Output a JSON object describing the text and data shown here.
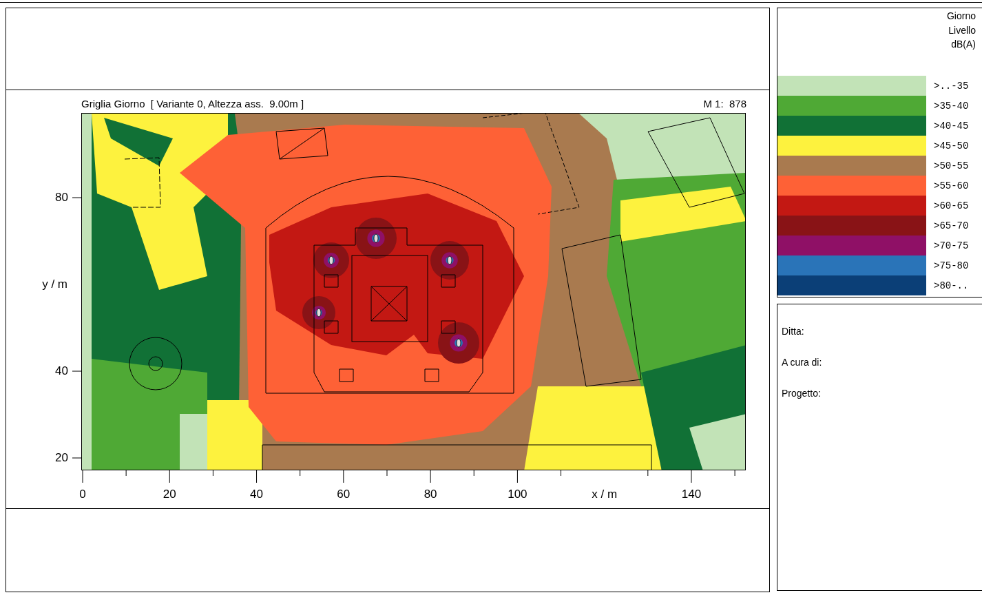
{
  "map_header": {
    "title": "Griglia Giorno  [ Variante 0, Altezza ass.  9.00m ]",
    "scale": "M 1:  878"
  },
  "x_axis": [
    {
      "kind": "tick",
      "text": "0"
    },
    {
      "kind": "tick",
      "text": "20"
    },
    {
      "kind": "tick",
      "text": "40"
    },
    {
      "kind": "tick",
      "text": "60"
    },
    {
      "kind": "tick",
      "text": "80"
    },
    {
      "kind": "tick",
      "text": "100"
    },
    {
      "kind": "label",
      "text": "x / m"
    },
    {
      "kind": "tick",
      "text": "140"
    }
  ],
  "y_axis": [
    {
      "kind": "tick",
      "text": "80"
    },
    {
      "kind": "label",
      "text": "y / m"
    },
    {
      "kind": "tick",
      "text": "40"
    },
    {
      "kind": "tick",
      "text": "20"
    }
  ],
  "legend": {
    "title_lines": [
      "Giorno",
      "Livello",
      "dB(A)"
    ],
    "items": [
      {
        "label": ">..-35",
        "color": "#c2e3b7"
      },
      {
        "label": ">35-40",
        "color": "#4fa935"
      },
      {
        "label": ">40-45",
        "color": "#117136"
      },
      {
        "label": ">45-50",
        "color": "#fdf23e"
      },
      {
        "label": ">50-55",
        "color": "#a97a4f"
      },
      {
        "label": ">55-60",
        "color": "#fe6136"
      },
      {
        "label": ">60-65",
        "color": "#c31813"
      },
      {
        "label": ">65-70",
        "color": "#891316"
      },
      {
        "label": ">70-75",
        "color": "#8f1066"
      },
      {
        "label": ">75-80",
        "color": "#2a74b8"
      },
      {
        "label": ">80-..",
        "color": "#0b3f77"
      }
    ]
  },
  "info_fields": [
    {
      "label": "Ditta:"
    },
    {
      "label": "A cura di:"
    },
    {
      "label": "Progetto:"
    }
  ]
}
